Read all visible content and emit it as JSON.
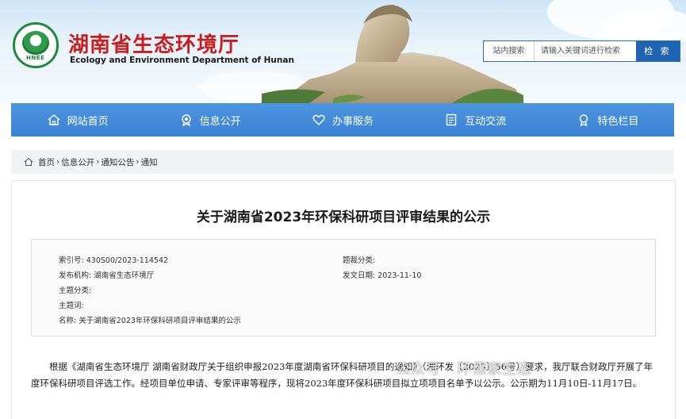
{
  "header": {
    "site_name_cn": "湖南省生态环境厅",
    "site_name_en": "Ecology and Environment Department of Hunan",
    "logo_text": "HNEE",
    "search": {
      "scope": "站内搜索",
      "placeholder": "请输入关键词进行检索",
      "button": "检 索"
    }
  },
  "nav": [
    {
      "label": "网站首页",
      "icon": "home-icon"
    },
    {
      "label": "信息公开",
      "icon": "badge-icon"
    },
    {
      "label": "办事服务",
      "icon": "heart-icon"
    },
    {
      "label": "互动交流",
      "icon": "document-icon"
    },
    {
      "label": "特色栏目",
      "icon": "award-icon"
    }
  ],
  "breadcrumb": [
    "首页",
    "信息公开",
    "通知公告",
    "通知"
  ],
  "breadcrumb_sep": "›",
  "article": {
    "title": "关于湖南省2023年环保科研项目评审结果的公示",
    "meta": {
      "index_label": "索引号:",
      "index_value": "430S00/2023-114542",
      "category_label": "题裁分类:",
      "category_value": "",
      "publisher_label": "发布机构:",
      "publisher_value": "湖南省生态环境厅",
      "date_label": "发文日期:",
      "date_value": "2023-11-10",
      "topic_label": "主题分类:",
      "topic_value": "",
      "keywords_label": "主题词:",
      "keywords_value": "",
      "name_label": "名称:",
      "name_value": "关于湖南省2023年环保科研项目评审结果的公示"
    },
    "body": "根据《湖南省生态环境厅 湖南省财政厅关于组织申报2023年度湖南省环保科研项目的通知》（湘环发〔2023〕56号）要求，我厅联合财政厅开展了年度环保科研项目评选工作。经项目单位申请、专家评审等程序，现将2023年度环保科研项目拟立项项目名单予以公示。公示期为11月10日-11月17日。"
  },
  "watermark": "公众号 · 环保家生态",
  "colors": {
    "nav_blue": "#3b82d3",
    "title_red": "#c81e1e",
    "search_blue": "#1f64b3"
  }
}
